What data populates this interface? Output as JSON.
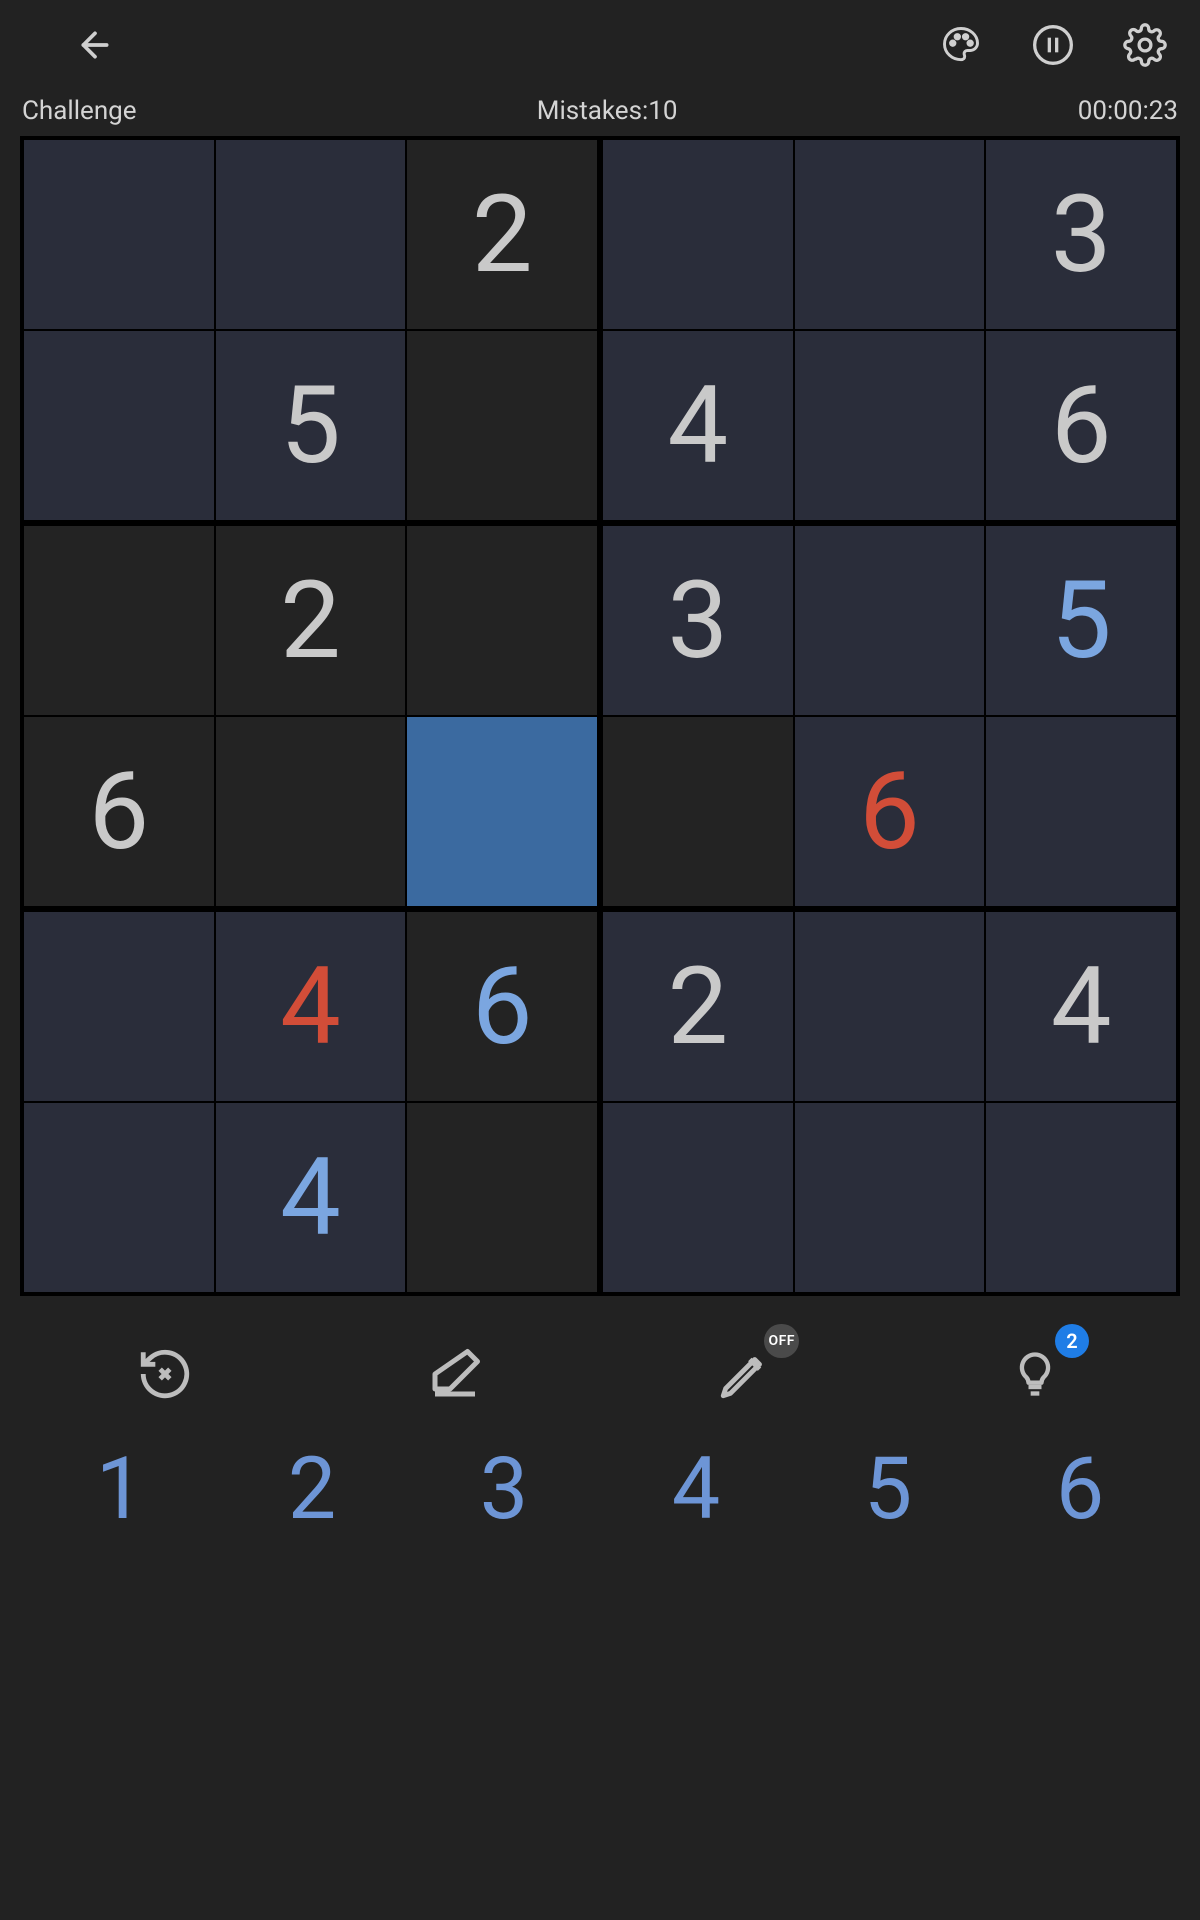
{
  "status": {
    "difficulty": "Challenge",
    "mistakes_label": "Mistakes:",
    "mistakes_count": "10",
    "timer": "00:00:23"
  },
  "tools": {
    "pencil_badge": "OFF",
    "hint_badge": "2"
  },
  "numpad": [
    "1",
    "2",
    "3",
    "4",
    "5",
    "6"
  ],
  "board": {
    "rows": 6,
    "cols": 6,
    "selected": [
      3,
      2
    ],
    "cells": [
      [
        {
          "v": "",
          "style": "mid",
          "color": "grey"
        },
        {
          "v": "",
          "style": "mid",
          "color": "grey"
        },
        {
          "v": "2",
          "style": "dark",
          "color": "grey"
        },
        {
          "v": "",
          "style": "mid",
          "color": "grey"
        },
        {
          "v": "",
          "style": "mid",
          "color": "grey"
        },
        {
          "v": "3",
          "style": "mid",
          "color": "grey"
        }
      ],
      [
        {
          "v": "",
          "style": "mid",
          "color": "grey"
        },
        {
          "v": "5",
          "style": "mid",
          "color": "grey"
        },
        {
          "v": "",
          "style": "dark",
          "color": "grey"
        },
        {
          "v": "4",
          "style": "mid",
          "color": "grey"
        },
        {
          "v": "",
          "style": "mid",
          "color": "grey"
        },
        {
          "v": "6",
          "style": "mid",
          "color": "grey"
        }
      ],
      [
        {
          "v": "",
          "style": "dark",
          "color": "grey"
        },
        {
          "v": "2",
          "style": "dark",
          "color": "grey"
        },
        {
          "v": "",
          "style": "dark",
          "color": "grey"
        },
        {
          "v": "3",
          "style": "mid",
          "color": "grey"
        },
        {
          "v": "",
          "style": "mid",
          "color": "grey"
        },
        {
          "v": "5",
          "style": "mid",
          "color": "blue"
        }
      ],
      [
        {
          "v": "6",
          "style": "dark",
          "color": "grey"
        },
        {
          "v": "",
          "style": "dark",
          "color": "grey"
        },
        {
          "v": "",
          "style": "selected",
          "color": "grey"
        },
        {
          "v": "",
          "style": "dark",
          "color": "grey"
        },
        {
          "v": "6",
          "style": "mid",
          "color": "red"
        },
        {
          "v": "",
          "style": "mid",
          "color": "grey"
        }
      ],
      [
        {
          "v": "",
          "style": "mid",
          "color": "grey"
        },
        {
          "v": "4",
          "style": "mid",
          "color": "red"
        },
        {
          "v": "6",
          "style": "dark",
          "color": "blue"
        },
        {
          "v": "2",
          "style": "mid",
          "color": "grey"
        },
        {
          "v": "",
          "style": "mid",
          "color": "grey"
        },
        {
          "v": "4",
          "style": "mid",
          "color": "grey"
        }
      ],
      [
        {
          "v": "",
          "style": "mid",
          "color": "grey"
        },
        {
          "v": "4",
          "style": "mid",
          "color": "blue"
        },
        {
          "v": "",
          "style": "dark",
          "color": "grey"
        },
        {
          "v": "",
          "style": "mid",
          "color": "grey"
        },
        {
          "v": "",
          "style": "mid",
          "color": "grey"
        },
        {
          "v": "",
          "style": "mid",
          "color": "grey"
        }
      ]
    ]
  }
}
